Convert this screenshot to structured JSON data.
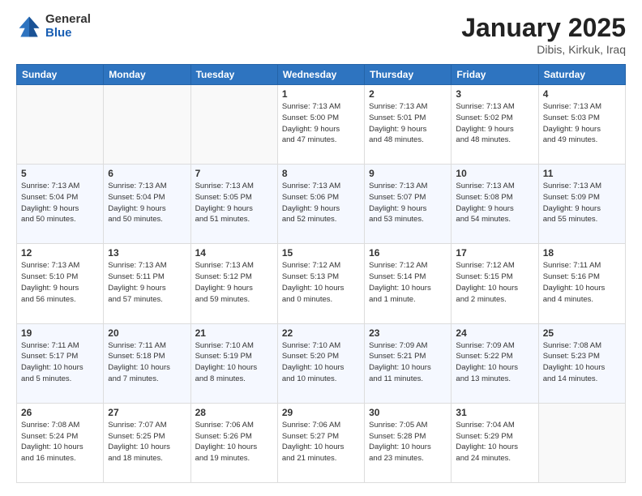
{
  "logo": {
    "general": "General",
    "blue": "Blue"
  },
  "title": {
    "month": "January 2025",
    "location": "Dibis, Kirkuk, Iraq"
  },
  "weekdays": [
    "Sunday",
    "Monday",
    "Tuesday",
    "Wednesday",
    "Thursday",
    "Friday",
    "Saturday"
  ],
  "weeks": [
    [
      {
        "day": "",
        "info": ""
      },
      {
        "day": "",
        "info": ""
      },
      {
        "day": "",
        "info": ""
      },
      {
        "day": "1",
        "info": "Sunrise: 7:13 AM\nSunset: 5:00 PM\nDaylight: 9 hours\nand 47 minutes."
      },
      {
        "day": "2",
        "info": "Sunrise: 7:13 AM\nSunset: 5:01 PM\nDaylight: 9 hours\nand 48 minutes."
      },
      {
        "day": "3",
        "info": "Sunrise: 7:13 AM\nSunset: 5:02 PM\nDaylight: 9 hours\nand 48 minutes."
      },
      {
        "day": "4",
        "info": "Sunrise: 7:13 AM\nSunset: 5:03 PM\nDaylight: 9 hours\nand 49 minutes."
      }
    ],
    [
      {
        "day": "5",
        "info": "Sunrise: 7:13 AM\nSunset: 5:04 PM\nDaylight: 9 hours\nand 50 minutes."
      },
      {
        "day": "6",
        "info": "Sunrise: 7:13 AM\nSunset: 5:04 PM\nDaylight: 9 hours\nand 50 minutes."
      },
      {
        "day": "7",
        "info": "Sunrise: 7:13 AM\nSunset: 5:05 PM\nDaylight: 9 hours\nand 51 minutes."
      },
      {
        "day": "8",
        "info": "Sunrise: 7:13 AM\nSunset: 5:06 PM\nDaylight: 9 hours\nand 52 minutes."
      },
      {
        "day": "9",
        "info": "Sunrise: 7:13 AM\nSunset: 5:07 PM\nDaylight: 9 hours\nand 53 minutes."
      },
      {
        "day": "10",
        "info": "Sunrise: 7:13 AM\nSunset: 5:08 PM\nDaylight: 9 hours\nand 54 minutes."
      },
      {
        "day": "11",
        "info": "Sunrise: 7:13 AM\nSunset: 5:09 PM\nDaylight: 9 hours\nand 55 minutes."
      }
    ],
    [
      {
        "day": "12",
        "info": "Sunrise: 7:13 AM\nSunset: 5:10 PM\nDaylight: 9 hours\nand 56 minutes."
      },
      {
        "day": "13",
        "info": "Sunrise: 7:13 AM\nSunset: 5:11 PM\nDaylight: 9 hours\nand 57 minutes."
      },
      {
        "day": "14",
        "info": "Sunrise: 7:13 AM\nSunset: 5:12 PM\nDaylight: 9 hours\nand 59 minutes."
      },
      {
        "day": "15",
        "info": "Sunrise: 7:12 AM\nSunset: 5:13 PM\nDaylight: 10 hours\nand 0 minutes."
      },
      {
        "day": "16",
        "info": "Sunrise: 7:12 AM\nSunset: 5:14 PM\nDaylight: 10 hours\nand 1 minute."
      },
      {
        "day": "17",
        "info": "Sunrise: 7:12 AM\nSunset: 5:15 PM\nDaylight: 10 hours\nand 2 minutes."
      },
      {
        "day": "18",
        "info": "Sunrise: 7:11 AM\nSunset: 5:16 PM\nDaylight: 10 hours\nand 4 minutes."
      }
    ],
    [
      {
        "day": "19",
        "info": "Sunrise: 7:11 AM\nSunset: 5:17 PM\nDaylight: 10 hours\nand 5 minutes."
      },
      {
        "day": "20",
        "info": "Sunrise: 7:11 AM\nSunset: 5:18 PM\nDaylight: 10 hours\nand 7 minutes."
      },
      {
        "day": "21",
        "info": "Sunrise: 7:10 AM\nSunset: 5:19 PM\nDaylight: 10 hours\nand 8 minutes."
      },
      {
        "day": "22",
        "info": "Sunrise: 7:10 AM\nSunset: 5:20 PM\nDaylight: 10 hours\nand 10 minutes."
      },
      {
        "day": "23",
        "info": "Sunrise: 7:09 AM\nSunset: 5:21 PM\nDaylight: 10 hours\nand 11 minutes."
      },
      {
        "day": "24",
        "info": "Sunrise: 7:09 AM\nSunset: 5:22 PM\nDaylight: 10 hours\nand 13 minutes."
      },
      {
        "day": "25",
        "info": "Sunrise: 7:08 AM\nSunset: 5:23 PM\nDaylight: 10 hours\nand 14 minutes."
      }
    ],
    [
      {
        "day": "26",
        "info": "Sunrise: 7:08 AM\nSunset: 5:24 PM\nDaylight: 10 hours\nand 16 minutes."
      },
      {
        "day": "27",
        "info": "Sunrise: 7:07 AM\nSunset: 5:25 PM\nDaylight: 10 hours\nand 18 minutes."
      },
      {
        "day": "28",
        "info": "Sunrise: 7:06 AM\nSunset: 5:26 PM\nDaylight: 10 hours\nand 19 minutes."
      },
      {
        "day": "29",
        "info": "Sunrise: 7:06 AM\nSunset: 5:27 PM\nDaylight: 10 hours\nand 21 minutes."
      },
      {
        "day": "30",
        "info": "Sunrise: 7:05 AM\nSunset: 5:28 PM\nDaylight: 10 hours\nand 23 minutes."
      },
      {
        "day": "31",
        "info": "Sunrise: 7:04 AM\nSunset: 5:29 PM\nDaylight: 10 hours\nand 24 minutes."
      },
      {
        "day": "",
        "info": ""
      }
    ]
  ]
}
